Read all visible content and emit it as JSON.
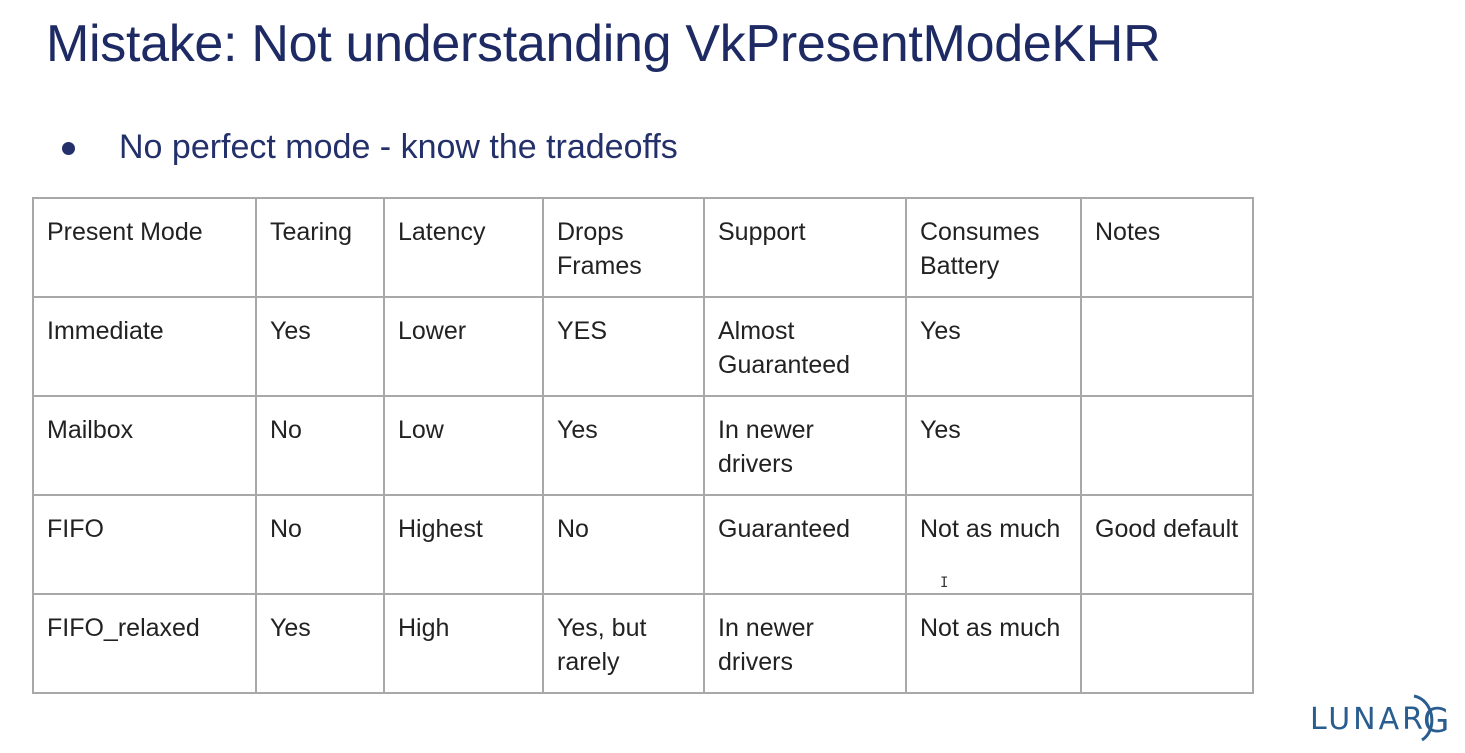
{
  "slide": {
    "title": "Mistake: Not understanding VkPresentModeKHR",
    "bullet": "No perfect mode - know the tradeoffs"
  },
  "table": {
    "headers": [
      "Present Mode",
      "Tearing",
      "Latency",
      "Drops Frames",
      "Support",
      "Consumes Battery",
      "Notes"
    ],
    "rows": [
      [
        "Immediate",
        "Yes",
        "Lower",
        "YES",
        "Almost Guaranteed",
        "Yes",
        ""
      ],
      [
        "Mailbox",
        "No",
        "Low",
        "Yes",
        "In newer drivers",
        "Yes",
        ""
      ],
      [
        "FIFO",
        "No",
        "Highest",
        "No",
        "Guaranteed",
        "Not as much",
        "Good default"
      ],
      [
        "FIFO_relaxed",
        "Yes",
        "High",
        "Yes, but rarely",
        "In newer drivers",
        "Not as much",
        ""
      ]
    ]
  },
  "logo": {
    "text": "LUNAR",
    "letter": "G",
    "color": "#2a5d8f"
  },
  "colors": {
    "title": "#1d2a63",
    "border": "#a8a8a8"
  },
  "cursor": "I"
}
